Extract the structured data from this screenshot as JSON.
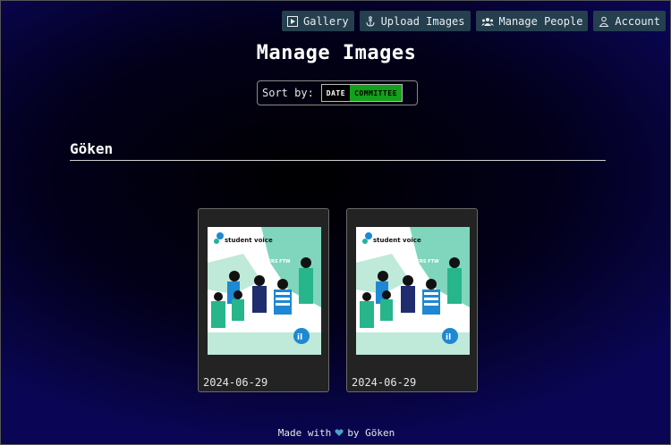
{
  "nav": {
    "gallery": "Gallery",
    "upload": "Upload Images",
    "manage_people": "Manage People",
    "account": "Account"
  },
  "page_title": "Manage Images",
  "sort": {
    "label": "Sort by:",
    "options": [
      "DATE",
      "COMMITTEE"
    ],
    "selected": "COMMITTEE"
  },
  "section": {
    "title": "Göken"
  },
  "images": [
    {
      "date": "2024-06-29",
      "poster_brand": "student voice",
      "poster_banner": "CHICHERS FTW"
    },
    {
      "date": "2024-06-29",
      "poster_brand": "student voice",
      "poster_banner": "CHICHERS FTW"
    }
  ],
  "footer": {
    "before": "Made with",
    "after": "by Göken",
    "heart_icon": "heart-icon"
  },
  "colors": {
    "nav_bg": "#253f4e",
    "selected_sort": "#13a01a",
    "heart": "#4aa3c8"
  }
}
